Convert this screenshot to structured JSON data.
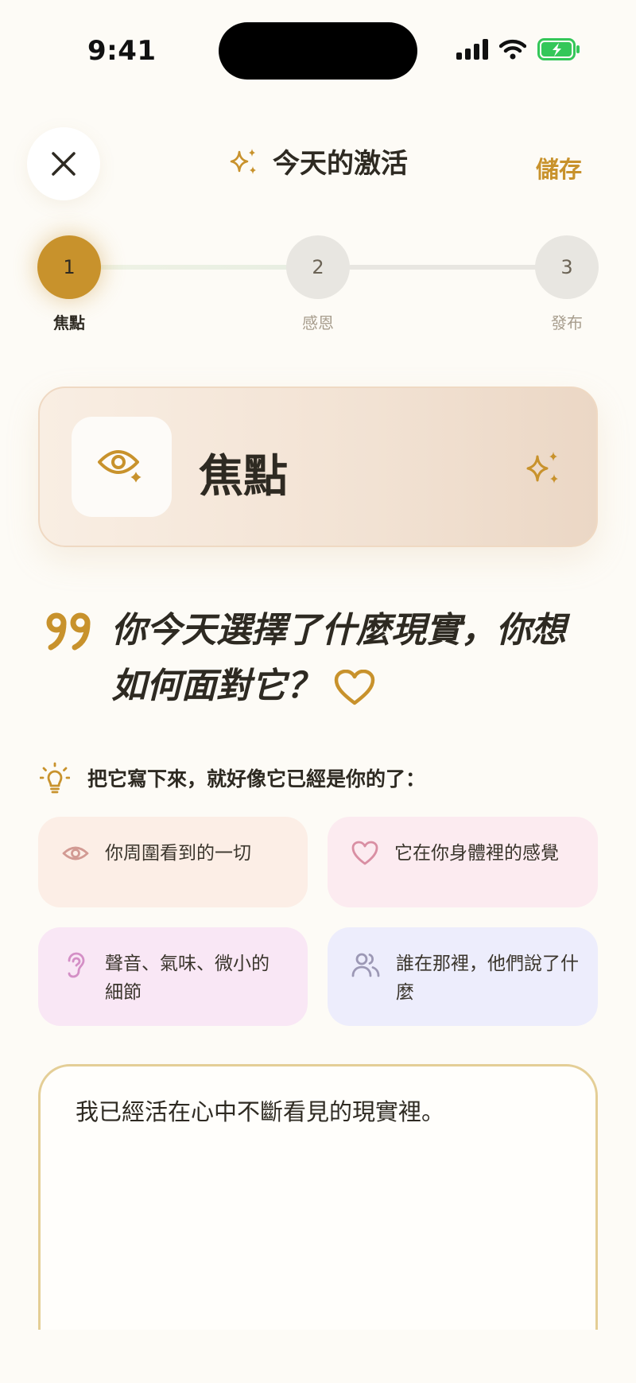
{
  "status_bar": {
    "time": "9:41"
  },
  "header": {
    "title": "今天的激活",
    "save_label": "儲存"
  },
  "stepper": {
    "steps": [
      {
        "number": "1",
        "label": "焦點",
        "state": "active"
      },
      {
        "number": "2",
        "label": "感恩",
        "state": "pending"
      },
      {
        "number": "3",
        "label": "發布",
        "state": "pending"
      }
    ]
  },
  "focus_card": {
    "title": "焦點"
  },
  "question": {
    "text": "你今天選擇了什麼現實，你想如何面對它？"
  },
  "hint": {
    "text": "把它寫下來，就好像它已經是你的了："
  },
  "prompts": [
    {
      "text": "你周圍看到的一切",
      "icon": "eye-icon"
    },
    {
      "text": "它在你身體裡的感覺",
      "icon": "heart-icon"
    },
    {
      "text": "聲音、氣味、微小的細節",
      "icon": "ear-icon"
    },
    {
      "text": "誰在那裡，他們說了什麼",
      "icon": "users-icon"
    }
  ],
  "entry": {
    "value": "我已經活在心中不斷看見的現實裡。"
  },
  "colors": {
    "accent": "#C8922C",
    "background": "#FDFBF6",
    "text": "#2E2A22"
  }
}
